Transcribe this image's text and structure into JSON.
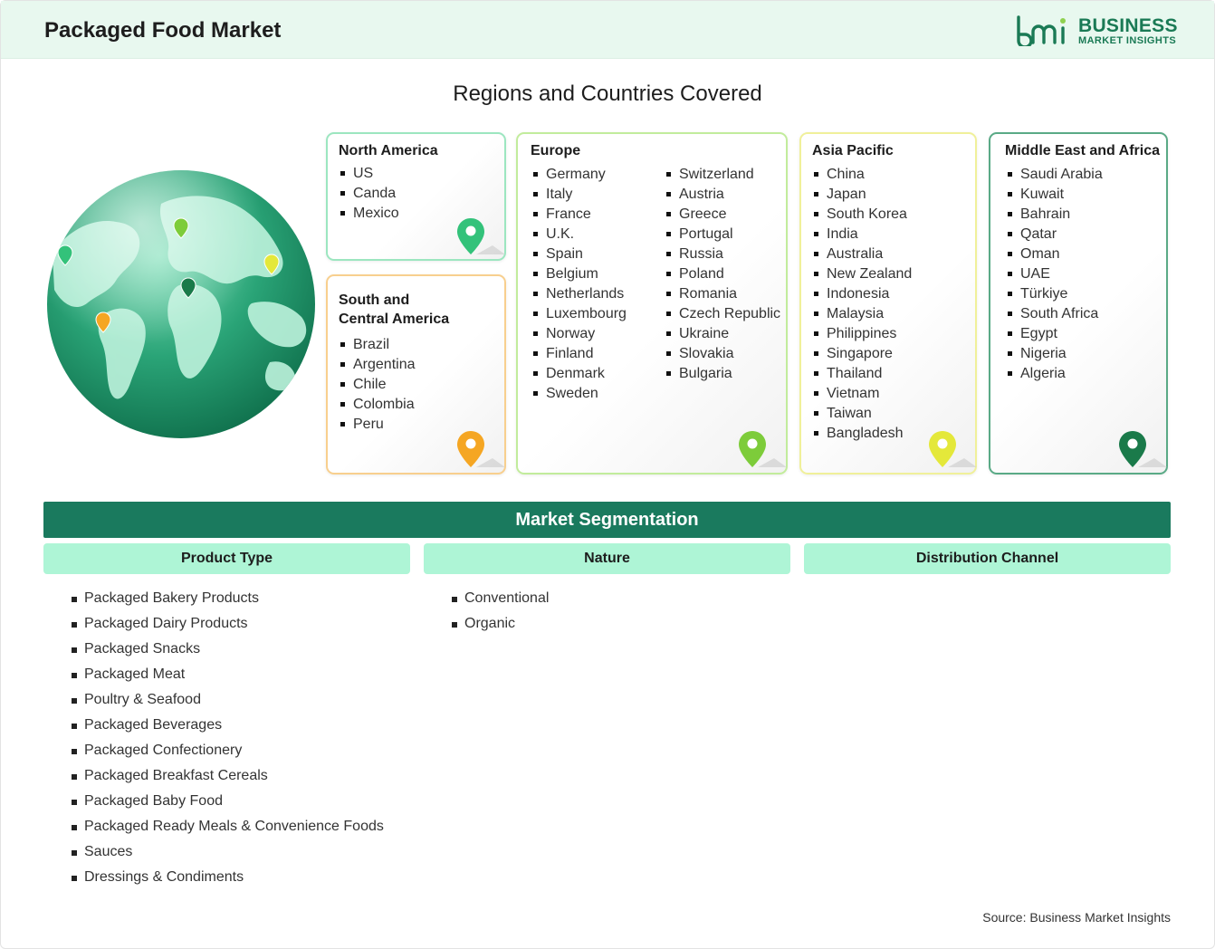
{
  "header": {
    "title": "Packaged Food Market",
    "logo_line1": "BUSINESS",
    "logo_line2": "MARKET INSIGHTS",
    "logo_mark_text": "bmi"
  },
  "regions": {
    "title": "Regions and Countries Covered",
    "north_america": {
      "name": "North America",
      "countries": [
        "US",
        "Canda",
        "Mexico"
      ]
    },
    "south_central_america": {
      "name_line1": "South and",
      "name_line2": "Central America",
      "countries": [
        "Brazil",
        "Argentina",
        "Chile",
        "Colombia",
        "Peru"
      ]
    },
    "europe": {
      "name": "Europe",
      "countries_col1": [
        "Germany",
        "Italy",
        "France",
        "U.K.",
        "Spain",
        "Belgium",
        "Netherlands",
        "Luxembourg",
        "Norway",
        "Finland",
        "Denmark",
        "Sweden"
      ],
      "countries_col2": [
        "Switzerland",
        "Austria",
        "Greece",
        "Portugal",
        "Russia",
        "Poland",
        "Romania",
        "Czech Republic",
        "Ukraine",
        "Slovakia",
        "Bulgaria"
      ]
    },
    "asia_pacific": {
      "name": "Asia Pacific",
      "countries": [
        "China",
        "Japan",
        "South Korea",
        "India",
        "Australia",
        "New Zealand",
        "Indonesia",
        "Malaysia",
        "Philippines",
        "Singapore",
        "Thailand",
        "Vietnam",
        "Taiwan",
        "Bangladesh"
      ]
    },
    "middle_east_africa": {
      "name": "Middle East and Africa",
      "countries": [
        "Saudi Arabia",
        "Kuwait",
        "Bahrain",
        "Qatar",
        "Oman",
        "UAE",
        "Türkiye",
        "South Africa",
        "Egypt",
        "Nigeria",
        "Algeria"
      ]
    }
  },
  "segmentation": {
    "title": "Market Segmentation",
    "product_type": {
      "label": "Product Type",
      "items": [
        "Packaged Bakery Products",
        "Packaged Dairy Products",
        "Packaged Snacks",
        "Packaged Meat",
        "Poultry & Seafood",
        "Packaged Beverages",
        "Packaged Confectionery",
        "Packaged Breakfast Cereals",
        "Packaged Baby Food",
        "Packaged Ready Meals & Convenience Foods",
        "Sauces",
        "Dressings & Condiments"
      ]
    },
    "nature": {
      "label": "Nature",
      "items": [
        "Conventional",
        "Organic"
      ]
    },
    "distribution_channel": {
      "label": "Distribution Channel",
      "items": []
    }
  },
  "source": "Source: Business Market Insights",
  "colors": {
    "brand_green": "#1a7a5e",
    "north_america": "#33c27a",
    "south_central_america": "#f5a623",
    "europe": "#7dcc3a",
    "asia_pacific": "#e4e83a",
    "middle_east_africa": "#1a7a4a",
    "segment_header": "#aef5d6"
  },
  "icons": [
    "globe-icon",
    "map-pin-icon",
    "bmi-logo-icon"
  ]
}
